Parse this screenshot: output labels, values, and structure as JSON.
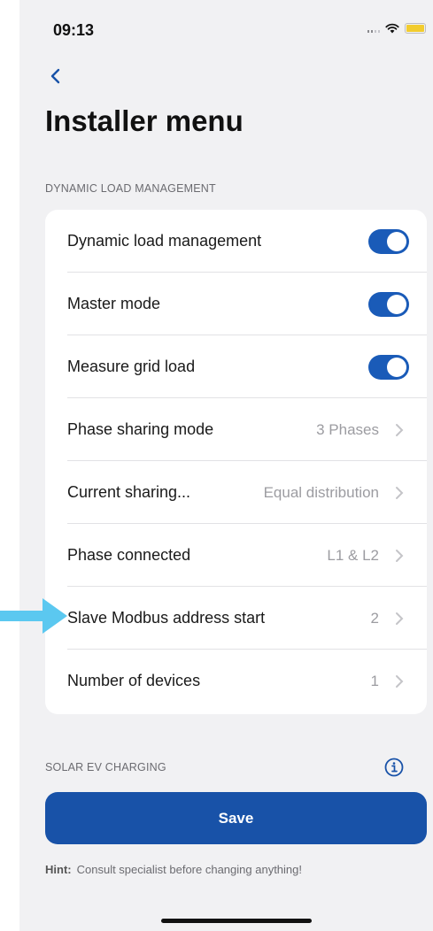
{
  "status_bar": {
    "time": "09:13"
  },
  "header": {
    "title": "Installer menu"
  },
  "sections": {
    "dynamic_load": "DYNAMIC LOAD MANAGEMENT",
    "solar": "SOLAR EV CHARGING"
  },
  "settings": {
    "dynamic_load_management": {
      "label": "Dynamic load management",
      "on": true
    },
    "master_mode": {
      "label": "Master mode",
      "on": true
    },
    "measure_grid_load": {
      "label": "Measure grid load",
      "on": true
    },
    "phase_sharing_mode": {
      "label": "Phase sharing mode",
      "value": "3 Phases"
    },
    "current_sharing": {
      "label": "Current sharing...",
      "value": "Equal distribution"
    },
    "phase_connected": {
      "label": "Phase connected",
      "value": "L1 & L2"
    },
    "slave_modbus": {
      "label": "Slave Modbus address start",
      "value": "2"
    },
    "number_of_devices": {
      "label": "Number of devices",
      "value": "1"
    }
  },
  "save_button": {
    "label": "Save"
  },
  "hint": {
    "label": "Hint:",
    "text": "Consult specialist before changing anything!"
  },
  "icons": {
    "back": "chevron-left-icon",
    "chevron": "chevron-right-icon",
    "info": "info-icon",
    "annotation_arrow": "arrow-right-icon"
  },
  "colors": {
    "accent": "#1852a8",
    "toggle_on": "#1a5bb8",
    "annotation": "#5bc8f0",
    "battery": "#f2cc2e",
    "background": "#f1f1f3"
  }
}
